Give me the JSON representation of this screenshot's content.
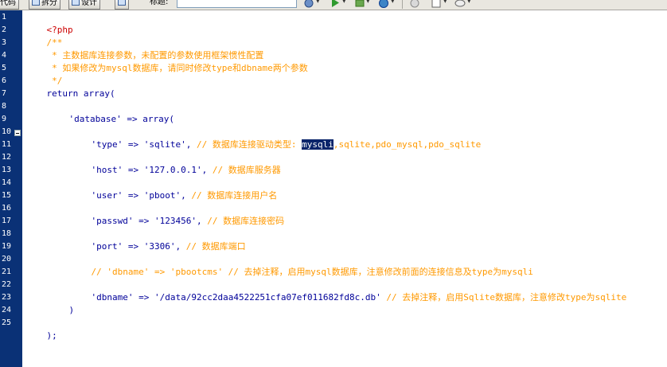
{
  "toolbar": {
    "left_label": "代码",
    "split_label": "拆分",
    "design_label": "设计",
    "title_label": "标题:",
    "title_value": ""
  },
  "line_numbers": [
    "1",
    "2",
    "3",
    "4",
    "5",
    "6",
    "7",
    "8",
    "9",
    "10",
    "11",
    "12",
    "13",
    "14",
    "15",
    "16",
    "17",
    "18",
    "19",
    "20",
    "21",
    "22",
    "23",
    "24",
    "25"
  ],
  "code": {
    "l1": "<?php",
    "l2": "/**",
    "l3": " * 主数据库连接参数，未配置的参数使用框架惯性配置",
    "l4": " * 如果修改为mysql数据库，请同时修改type和dbname两个参数",
    "l5": " */",
    "l6": "return array(",
    "l8_key": "'database'",
    "l8_op": " => ",
    "l8_val": "array(",
    "l10_key": "'type'",
    "l10_op": " => ",
    "l10_val": "'sqlite',",
    "l10_cm_a": " // 数据库连接驱动类型: ",
    "l10_sel": "mysqli",
    "l10_cm_b": ",sqlite,pdo_mysql,pdo_sqlite",
    "l12_key": "'host'",
    "l12_op": " => ",
    "l12_val": "'127.0.0.1',",
    "l12_cm": " // 数据库服务器",
    "l14_key": "'user'",
    "l14_op": " => ",
    "l14_val": "'pboot',",
    "l14_cm": " // 数据库连接用户名",
    "l16_key": "'passwd'",
    "l16_op": " => ",
    "l16_val": "'123456',",
    "l16_cm": " // 数据库连接密码",
    "l18_key": "'port'",
    "l18_op": " => ",
    "l18_val": "'3306',",
    "l18_cm": " // 数据库端口",
    "l20": "// 'dbname' => 'pbootcms' // 去掉注释，启用mysql数据库，注意修改前面的连接信息及type为mysqli",
    "l22_key": "'dbname'",
    "l22_op": " => ",
    "l22_val": "'/data/92cc2daa4522251cfa07ef011682fd8c.db'",
    "l22_cm": " // 去掉注释，启用Sqlite数据库，注意修改type为sqlite",
    "l23": ")",
    "l25": ");"
  }
}
